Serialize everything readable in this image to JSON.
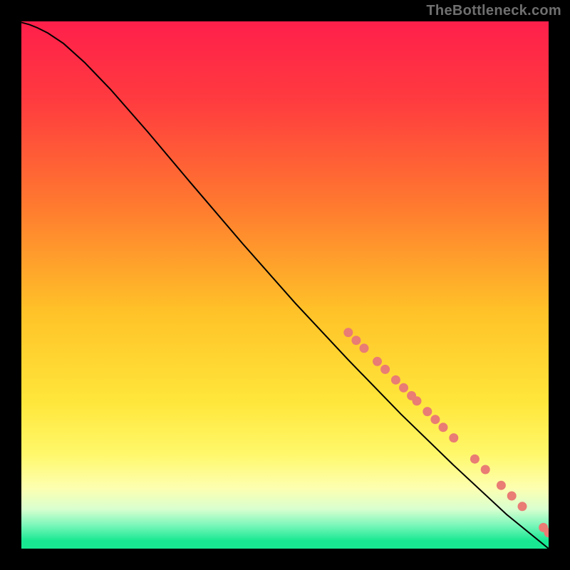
{
  "watermark": "TheBottleneck.com",
  "colors": {
    "stroke": "#000000",
    "dot_fill": "#e97c74",
    "dot_stroke": "#c75a52",
    "gradient_stops": [
      {
        "offset": 0.0,
        "color": "#ff1f4b"
      },
      {
        "offset": 0.15,
        "color": "#ff3b3f"
      },
      {
        "offset": 0.35,
        "color": "#ff7a2f"
      },
      {
        "offset": 0.55,
        "color": "#ffc228"
      },
      {
        "offset": 0.72,
        "color": "#ffe63a"
      },
      {
        "offset": 0.82,
        "color": "#fff86a"
      },
      {
        "offset": 0.885,
        "color": "#fdffb0"
      },
      {
        "offset": 0.925,
        "color": "#d9ffcf"
      },
      {
        "offset": 0.955,
        "color": "#7cf7bb"
      },
      {
        "offset": 0.985,
        "color": "#19e892"
      },
      {
        "offset": 1.0,
        "color": "#19e892"
      }
    ]
  },
  "chart_data": {
    "type": "line",
    "title": "",
    "xlabel": "",
    "ylabel": "",
    "xlim": [
      0,
      100
    ],
    "ylim": [
      0,
      100
    ],
    "curve": [
      {
        "x": 0.0,
        "y": 99.8
      },
      {
        "x": 1.5,
        "y": 99.4
      },
      {
        "x": 3.0,
        "y": 98.8
      },
      {
        "x": 5.0,
        "y": 97.8
      },
      {
        "x": 8.0,
        "y": 95.8
      },
      {
        "x": 12.0,
        "y": 92.2
      },
      {
        "x": 17.0,
        "y": 87.0
      },
      {
        "x": 24.0,
        "y": 79.0
      },
      {
        "x": 32.0,
        "y": 69.5
      },
      {
        "x": 42.0,
        "y": 57.8
      },
      {
        "x": 52.0,
        "y": 46.5
      },
      {
        "x": 62.0,
        "y": 35.8
      },
      {
        "x": 72.0,
        "y": 25.5
      },
      {
        "x": 82.0,
        "y": 15.8
      },
      {
        "x": 92.0,
        "y": 6.5
      },
      {
        "x": 100.0,
        "y": 0.0
      }
    ],
    "markers": [
      {
        "x": 62.0,
        "y": 41.0
      },
      {
        "x": 63.5,
        "y": 39.5
      },
      {
        "x": 65.0,
        "y": 38.0
      },
      {
        "x": 67.5,
        "y": 35.5
      },
      {
        "x": 69.0,
        "y": 34.0
      },
      {
        "x": 71.0,
        "y": 32.0
      },
      {
        "x": 72.5,
        "y": 30.5
      },
      {
        "x": 74.0,
        "y": 29.0
      },
      {
        "x": 75.0,
        "y": 28.0
      },
      {
        "x": 77.0,
        "y": 26.0
      },
      {
        "x": 78.5,
        "y": 24.5
      },
      {
        "x": 80.0,
        "y": 23.0
      },
      {
        "x": 82.0,
        "y": 21.0
      },
      {
        "x": 86.0,
        "y": 17.0
      },
      {
        "x": 88.0,
        "y": 15.0
      },
      {
        "x": 91.0,
        "y": 12.0
      },
      {
        "x": 93.0,
        "y": 10.0
      },
      {
        "x": 95.0,
        "y": 8.0
      },
      {
        "x": 99.0,
        "y": 4.0
      },
      {
        "x": 100.0,
        "y": 3.0
      }
    ]
  }
}
